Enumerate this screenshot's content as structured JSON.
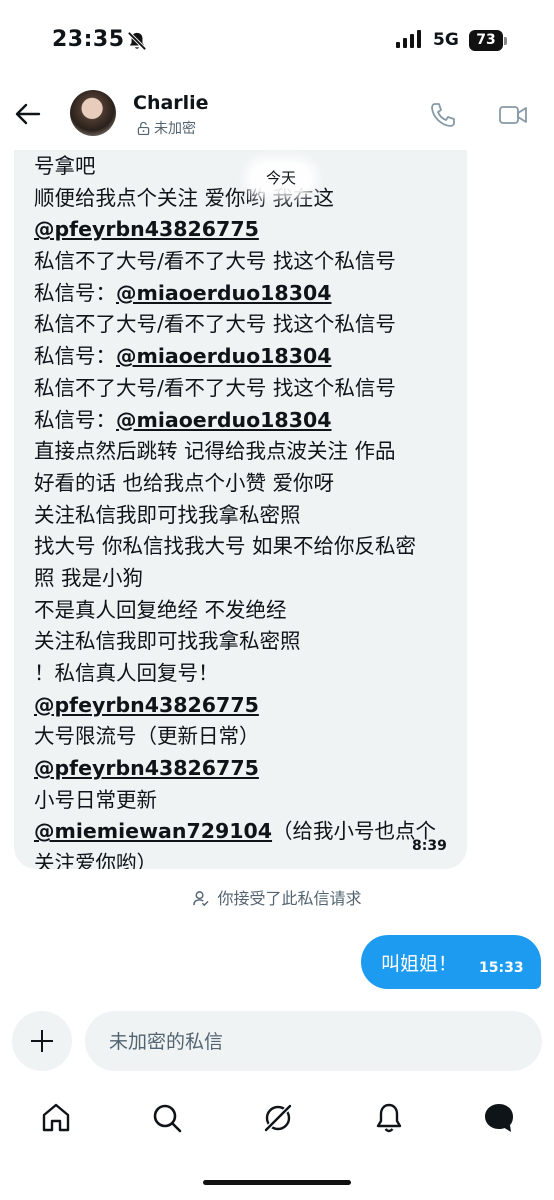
{
  "status": {
    "time": "23:35",
    "network": "5G",
    "battery": "73"
  },
  "header": {
    "name": "Charlie",
    "encryption": "未加密"
  },
  "today_label": "今天",
  "message_in": {
    "lines": [
      "号拿吧",
      "顺便给我点个关注 爱你哟 我在这",
      "@pfeyrbn43826775",
      "私信不了大号/看不了大号 找这个私信号",
      "私信号：@miaoerduo18304",
      "私信不了大号/看不了大号 找这个私信号",
      "私信号：@miaoerduo18304",
      "私信不了大号/看不了大号 找这个私信号",
      "私信号：@miaoerduo18304",
      "直接点然后跳转  记得给我点波关注 作品",
      "好看的话 也给我点个小赞 爱你呀",
      "关注私信我即可找我拿私密照",
      "找大号 你私信找我大号 如果不给你反私密",
      "照 我是小狗",
      "不是真人回复绝经 不发绝经",
      "关注私信我即可找我拿私密照",
      "！私信真人回复号！",
      "@pfeyrbn43826775",
      "大号限流号（更新日常）",
      "@pfeyrbn43826775",
      "小号日常更新",
      "@miemiewan729104（给我小号也点个",
      "关注爱你哟）"
    ],
    "time": "8:39"
  },
  "accepted_notice": "你接受了此私信请求",
  "message_out": {
    "text": "叫姐姐！",
    "time": "15:33"
  },
  "composer": {
    "placeholder": "未加密的私信"
  },
  "nav": [
    "home-icon",
    "search-icon",
    "grok-icon",
    "notifications-icon",
    "messages-icon"
  ]
}
